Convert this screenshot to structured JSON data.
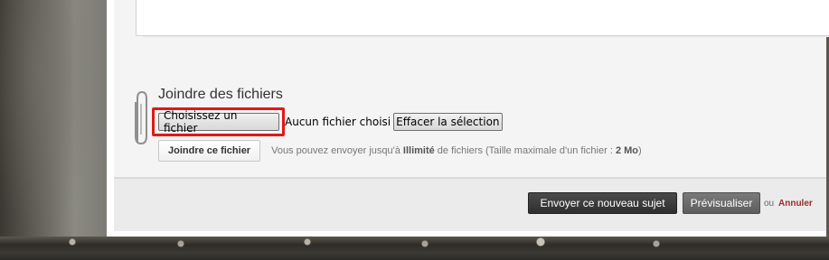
{
  "attachments": {
    "title": "Joindre des fichiers",
    "choose_label": "Choisissez un fichier",
    "no_file_text": "Aucun fichier choisi",
    "clear_label": "Effacer la sélection",
    "join_label": "Joindre ce fichier",
    "hint_before": "Vous pouvez envoyer jusqu'à ",
    "hint_limit": "Illimité",
    "hint_middle": " de fichiers (Taille maximale d'un fichier : ",
    "hint_size": "2 Mo",
    "hint_after": ")"
  },
  "footer": {
    "send_label": "Envoyer ce nouveau sujet",
    "preview_label": "Prévisualiser",
    "or_text": "ou",
    "cancel_label": "Annuler"
  },
  "icons": {
    "attachment": "paperclip-icon"
  },
  "colors": {
    "highlight": "#e01818",
    "cancel_link": "#9b2c2c",
    "primary_button": "#3a3a3a",
    "secondary_button": "#6b6b6b"
  }
}
